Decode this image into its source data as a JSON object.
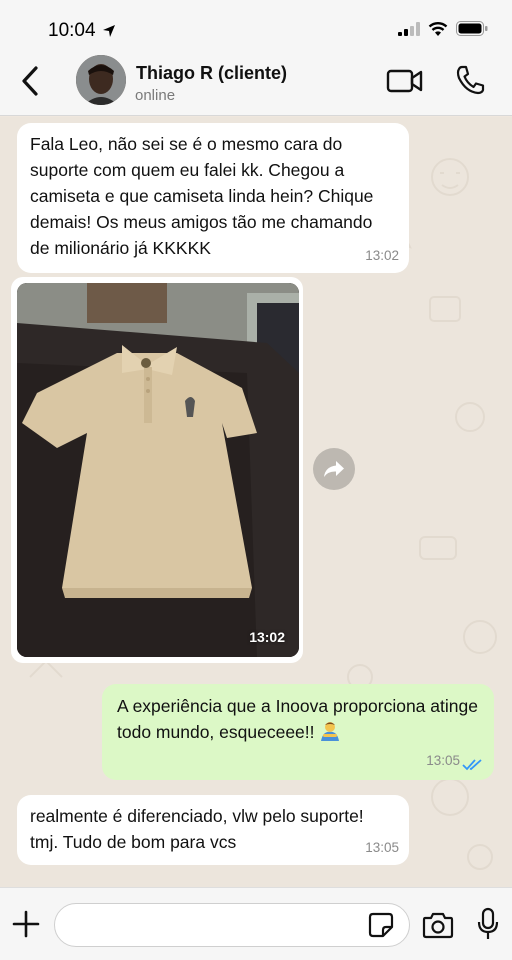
{
  "status_bar": {
    "time": "10:04"
  },
  "header": {
    "contact_name": "Thiago R (cliente)",
    "contact_status": "online"
  },
  "messages": [
    {
      "direction": "incoming",
      "text": "Fala Leo, não sei se é o mesmo cara do suporte com quem eu falei kk. Chegou a camiseta e que camiseta linda hein? Chique demais! Os meus amigos tão me chamando de milionário já KKKKK",
      "time": "13:02"
    },
    {
      "direction": "incoming",
      "type": "image",
      "time": "13:02"
    },
    {
      "direction": "outgoing",
      "text": "A experiência que a Inoova proporciona atinge todo mundo, esqueceee!!",
      "time": "13:05",
      "status": "read"
    },
    {
      "direction": "incoming",
      "text": "realmente é diferenciado, vlw pelo suporte! tmj. Tudo de bom para vcs",
      "time": "13:05"
    }
  ],
  "composer": {
    "placeholder": ""
  },
  "colors": {
    "incoming_bubble": "#ffffff",
    "outgoing_bubble": "#dcf8c6",
    "read_ticks": "#3497f9",
    "chat_background": "#ece5dc"
  }
}
